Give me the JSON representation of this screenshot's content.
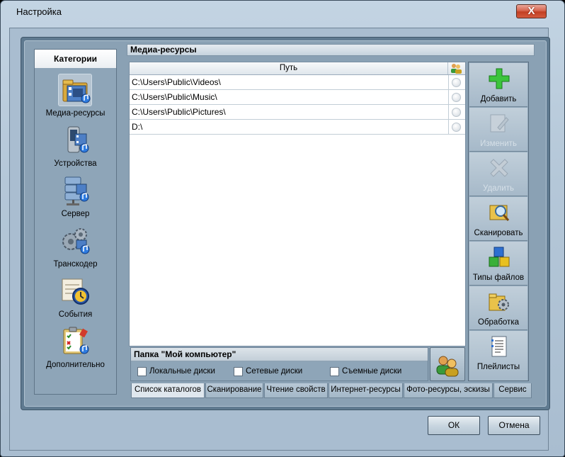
{
  "window": {
    "title": "Настройка",
    "close_glyph": "X"
  },
  "sidebar": {
    "header": "Категории",
    "items": [
      {
        "label": "Медиа-ресурсы",
        "icon": "media-resources-icon",
        "active": true
      },
      {
        "label": "Устройства",
        "icon": "devices-icon",
        "active": false
      },
      {
        "label": "Сервер",
        "icon": "server-icon",
        "active": false
      },
      {
        "label": "Транскодер",
        "icon": "transcoder-icon",
        "active": false
      },
      {
        "label": "События",
        "icon": "events-icon",
        "active": false
      },
      {
        "label": "Дополнительно",
        "icon": "advanced-icon",
        "active": false
      }
    ]
  },
  "media": {
    "title": "Медиа-ресурсы",
    "column_path": "Путь",
    "rows": [
      {
        "path": "C:\\Users\\Public\\Videos\\"
      },
      {
        "path": "C:\\Users\\Public\\Music\\"
      },
      {
        "path": "C:\\Users\\Public\\Pictures\\"
      },
      {
        "path": "D:\\"
      }
    ]
  },
  "toolbar": {
    "buttons": [
      {
        "label": "Добавить",
        "icon": "plus-icon",
        "enabled": true
      },
      {
        "label": "Изменить",
        "icon": "edit-icon",
        "enabled": false
      },
      {
        "label": "Удалить",
        "icon": "delete-x-icon",
        "enabled": false
      },
      {
        "label": "Сканировать",
        "icon": "scan-magnifier-icon",
        "enabled": true
      },
      {
        "label": "Типы файлов",
        "icon": "file-types-cubes-icon",
        "enabled": true
      },
      {
        "label": "Обработка",
        "icon": "processing-gear-icon",
        "enabled": true
      },
      {
        "label": "Плейлисты",
        "icon": "playlist-icon",
        "enabled": true
      }
    ]
  },
  "my_computer": {
    "title": "Папка \"Мой компьютер\"",
    "checkboxes": [
      {
        "label": "Локальные диски",
        "checked": false
      },
      {
        "label": "Сетевые диски",
        "checked": false
      },
      {
        "label": "Съемные диски",
        "checked": false
      }
    ]
  },
  "tabs": [
    {
      "label": "Список каталогов",
      "active": true
    },
    {
      "label": "Сканирование",
      "active": false
    },
    {
      "label": "Чтение свойств",
      "active": false
    },
    {
      "label": "Интернет-ресурсы",
      "active": false
    },
    {
      "label": "Фото-ресурсы, эскизы",
      "active": false
    },
    {
      "label": "Сервис",
      "active": false
    }
  ],
  "buttons": {
    "ok": "ОК",
    "cancel": "Отмена"
  }
}
